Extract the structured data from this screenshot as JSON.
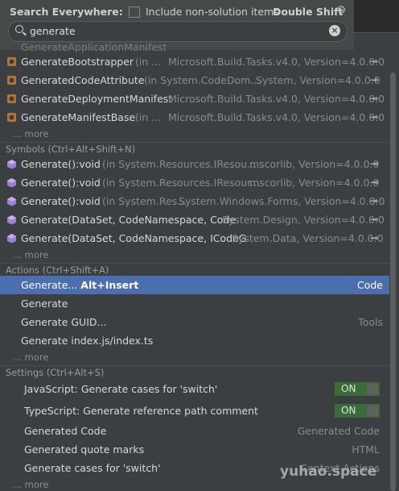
{
  "header": {
    "title": "Search Everywhere:",
    "include_label": "Include non-solution items",
    "shortcut": "Double Shift"
  },
  "search": {
    "value": "generate"
  },
  "classes": [
    {
      "name": "GenerateBootstrapper",
      "location": "(in ...",
      "assembly": "Microsoft.Build.Tasks.v4.0, Version=4.0.0.0"
    },
    {
      "name": "GeneratedCodeAttribute",
      "location": "(in System.CodeDom...",
      "assembly": "System, Version=4.0.0.0"
    },
    {
      "name": "GenerateDeploymentManifest",
      "location": "",
      "assembly": "Microsoft.Build.Tasks.v4.0, Version=4.0.0.0"
    },
    {
      "name": "GenerateManifestBase",
      "location": "(in ...",
      "assembly": "Microsoft.Build.Tasks.v4.0, Version=4.0.0.0"
    }
  ],
  "classes_more": "... more",
  "symbols_header": "Symbols (Ctrl+Alt+Shift+N)",
  "symbols": [
    {
      "name": "Generate():void",
      "location": "(in System.Resources.IResou...",
      "assembly": "mscorlib, Version=4.0.0.0"
    },
    {
      "name": "Generate():void",
      "location": "(in System.Resources.IResour...",
      "assembly": "mscorlib, Version=4.0.0.0"
    },
    {
      "name": "Generate():void",
      "location": "(in System.Res...",
      "assembly": "System.Windows.Forms, Version=4.0.0.0"
    },
    {
      "name": "Generate(DataSet, CodeNamespace, Code",
      "location": "",
      "assembly": "System.Design, Version=4.0.0.0"
    },
    {
      "name": "Generate(DataSet, CodeNamespace, ICodeG",
      "location": "",
      "assembly": "System.Data, Version=4.0.0.0"
    }
  ],
  "symbols_more": "... more",
  "actions_header": "Actions (Ctrl+Shift+A)",
  "actions": [
    {
      "name": "Generate... ",
      "shortcut": "Alt+Insert",
      "group": "Code"
    },
    {
      "name": "Generate",
      "shortcut": "",
      "group": ""
    },
    {
      "name": "Generate GUID...",
      "shortcut": "",
      "group": "Tools"
    },
    {
      "name": "Generate index.js/index.ts",
      "shortcut": "",
      "group": ""
    }
  ],
  "actions_more": "... more",
  "settings_header": "Settings (Ctrl+Alt+S)",
  "settings": [
    {
      "name": "JavaScript: Generate cases for 'switch'",
      "value": "ON"
    },
    {
      "name": "TypeScript: Generate reference path comment",
      "value": "ON"
    },
    {
      "name": "Generated Code",
      "value": "Generated Code"
    },
    {
      "name": "Generated quote marks",
      "value": "HTML"
    },
    {
      "name": "Generate cases for 'switch'",
      "value": "Context Actions"
    }
  ],
  "settings_more": "... more",
  "watermark": "yuhao.space",
  "colors": {
    "selection": "#4b6eaf",
    "background": "#3c3f41",
    "toggle_on": "#3b6b36"
  }
}
